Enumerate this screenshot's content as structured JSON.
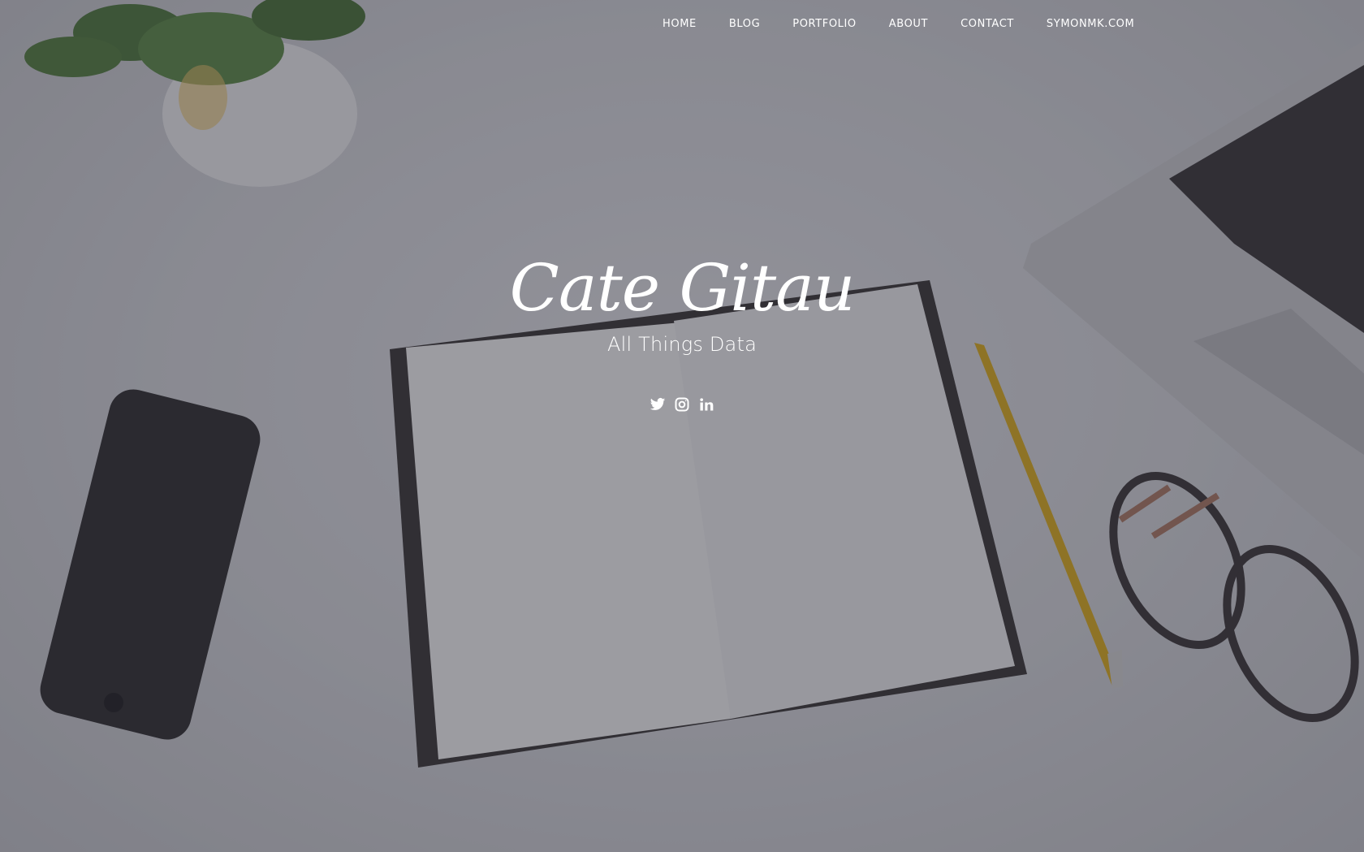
{
  "nav": {
    "items": [
      {
        "label": "HOME"
      },
      {
        "label": "BLOG"
      },
      {
        "label": "PORTFOLIO"
      },
      {
        "label": "ABOUT"
      },
      {
        "label": "CONTACT"
      },
      {
        "label": "SYMONMK.COM"
      }
    ]
  },
  "hero": {
    "title": "Cate Gitau",
    "subtitle": "All Things Data"
  },
  "social": {
    "icons": [
      "twitter-icon",
      "instagram-icon",
      "linkedin-icon"
    ]
  },
  "colors": {
    "text": "#ffffff",
    "overlay": "#28283480",
    "pencil": "#e2b11c"
  }
}
